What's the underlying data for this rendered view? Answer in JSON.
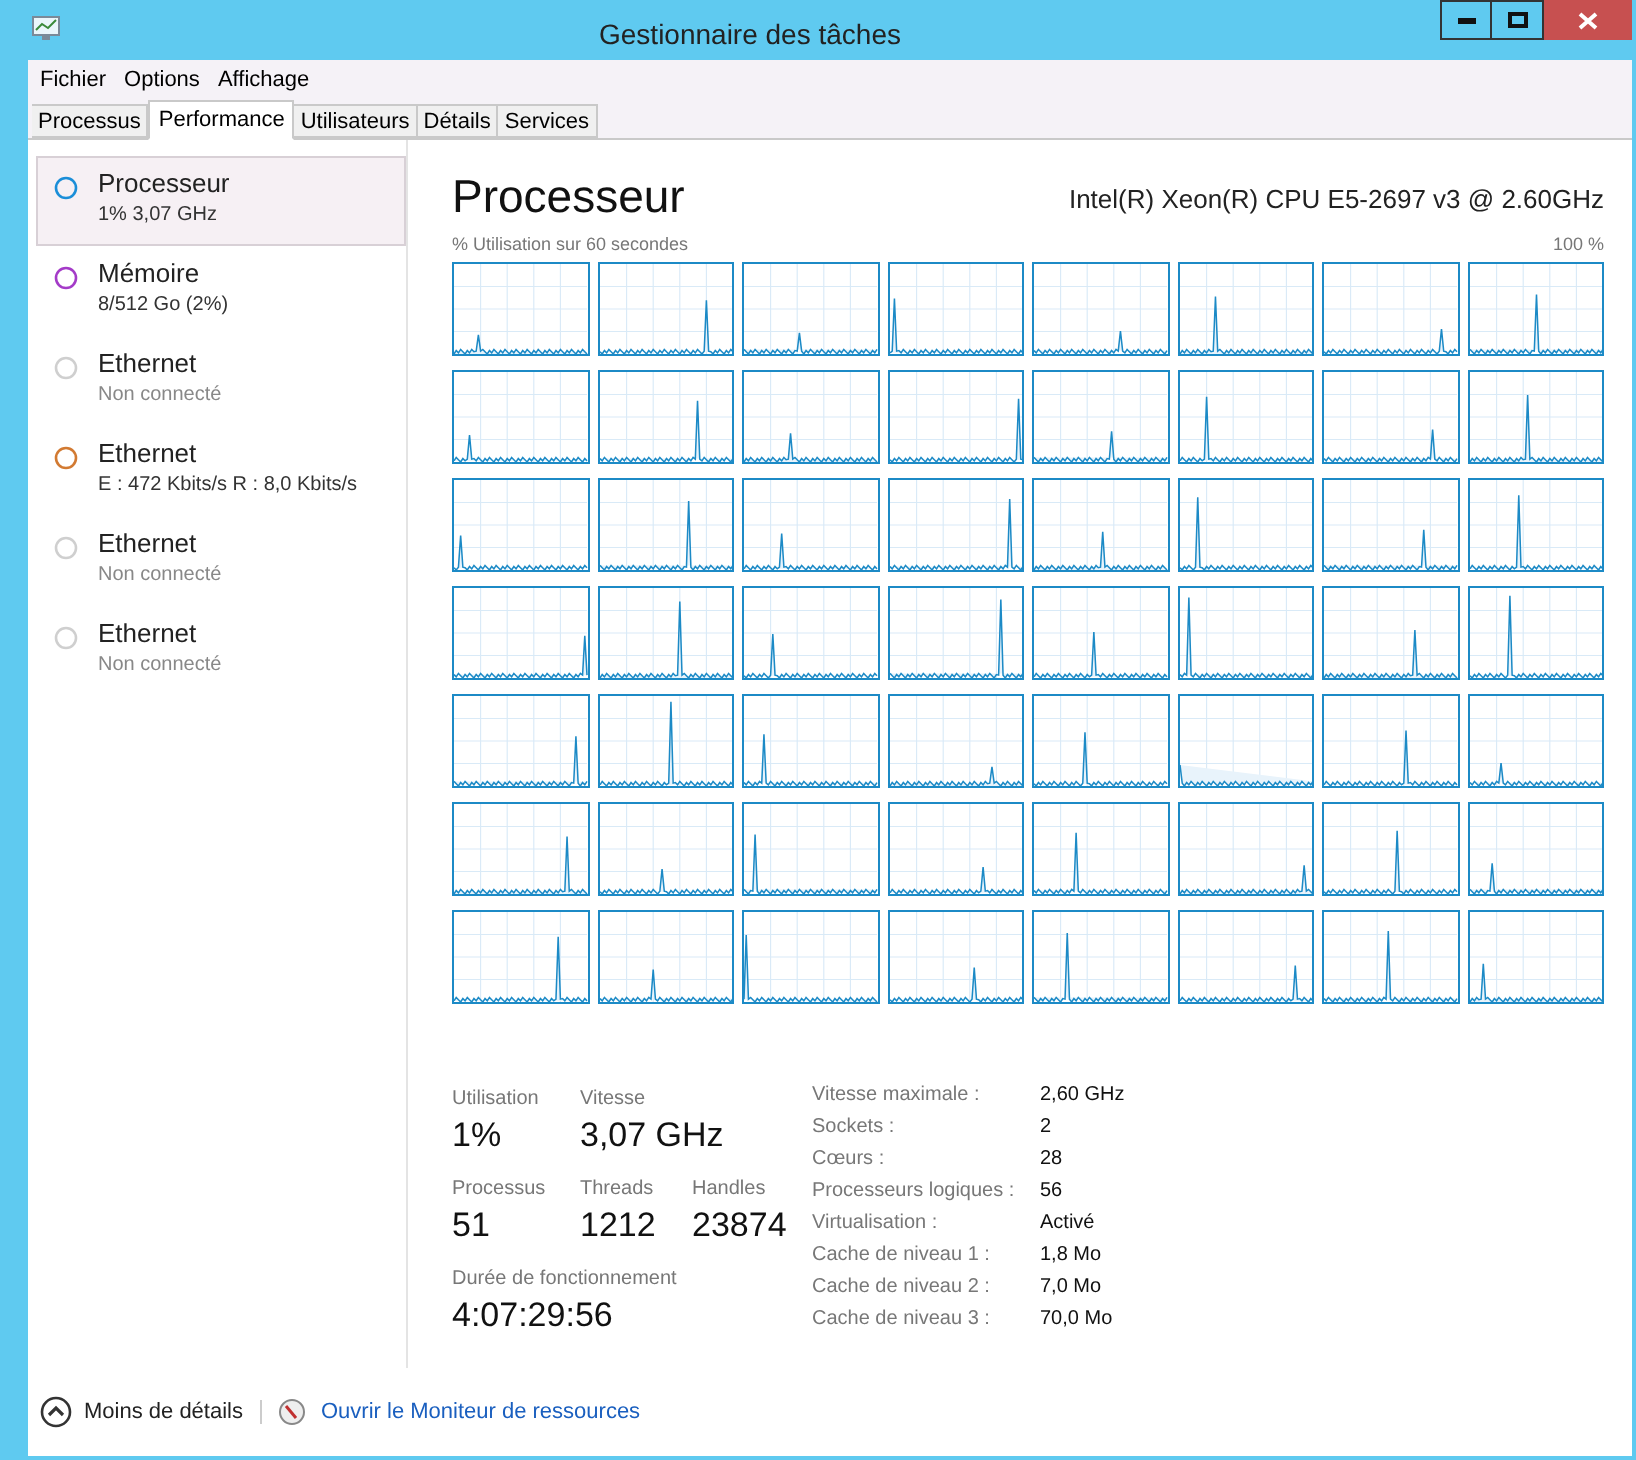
{
  "window": {
    "title": "Gestionnaire des tâches"
  },
  "menu": [
    "Fichier",
    "Options",
    "Affichage"
  ],
  "tabs": [
    {
      "label": "Processus",
      "selected": false
    },
    {
      "label": "Performance",
      "selected": true
    },
    {
      "label": "Utilisateurs",
      "selected": false
    },
    {
      "label": "Détails",
      "selected": false
    },
    {
      "label": "Services",
      "selected": false
    }
  ],
  "sidebar": {
    "items": [
      {
        "name": "Processeur",
        "detail": "1%  3,07 GHz",
        "color": "#1b8ed8",
        "selected": true
      },
      {
        "name": "Mémoire",
        "detail": "8/512 Go (2%)",
        "color": "#a43bc8",
        "selected": false
      },
      {
        "name": "Ethernet",
        "detail": "Non connecté",
        "color": "#cfcfcf",
        "selected": false
      },
      {
        "name": "Ethernet",
        "detail": "E : 472 Kbits/s R : 8,0 Kbits/s",
        "color": "#d27a32",
        "selected": false
      },
      {
        "name": "Ethernet",
        "detail": "Non connecté",
        "color": "#cfcfcf",
        "selected": false
      },
      {
        "name": "Ethernet",
        "detail": "Non connecté",
        "color": "#cfcfcf",
        "selected": false
      }
    ]
  },
  "panel": {
    "title": "Processeur",
    "cpu_name": "Intel(R) Xeon(R) CPU E5-2697 v3 @ 2.60GHz",
    "graph_caption": "% Utilisation sur 60 secondes",
    "graph_max": "100 %"
  },
  "stats": [
    {
      "label": "Utilisation",
      "value": "1%"
    },
    {
      "label": "Vitesse",
      "value": "3,07 GHz"
    },
    {
      "label": "Processus",
      "value": "51"
    },
    {
      "label": "Threads",
      "value": "1212"
    },
    {
      "label": "Handles",
      "value": "23874"
    },
    {
      "label": "Durée de fonctionnement",
      "value": "4:07:29:56"
    }
  ],
  "specs": [
    {
      "label": "Vitesse maximale :",
      "value": "2,60 GHz"
    },
    {
      "label": "Sockets :",
      "value": "2"
    },
    {
      "label": "Cœurs :",
      "value": "28"
    },
    {
      "label": "Processeurs logiques :",
      "value": "56"
    },
    {
      "label": "Virtualisation :",
      "value": "Activé"
    },
    {
      "label": "Cache de niveau 1 :",
      "value": "1,8 Mo"
    },
    {
      "label": "Cache de niveau 2 :",
      "value": "7,0 Mo"
    },
    {
      "label": "Cache de niveau 3 :",
      "value": "70,0 Mo"
    }
  ],
  "footer": {
    "less_details": "Moins de détails",
    "monitor_link": "Ouvrir le Moniteur de ressources"
  }
}
